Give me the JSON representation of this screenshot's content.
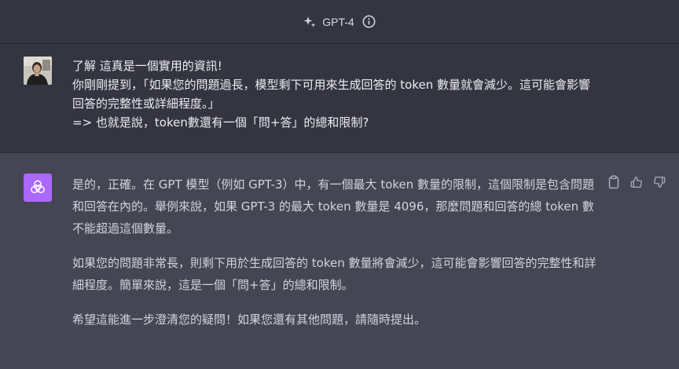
{
  "header": {
    "model_name": "GPT-4",
    "model_icon": "sparkle-icon",
    "info_icon": "info-icon"
  },
  "user_message": {
    "avatar": "user-avatar-photo",
    "text": "了解 這真是一個實用的資訊!\n你剛剛提到，「如果您的問題過長，模型剩下可用來生成回答的 token 數量就會減少。這可能會影響回答的完整性或詳細程度。」\n=> 也就是說，token數還有一個「問+答」的總和限制?"
  },
  "assistant_message": {
    "avatar": "openai-logo-icon",
    "paragraphs": [
      "是的，正確。在 GPT 模型（例如 GPT-3）中，有一個最大 token 數量的限制，這個限制是包含問題和回答在內的。舉例來說，如果 GPT-3 的最大 token 數量是 4096，那麼問題和回答的總 token 數不能超過這個數量。",
      "如果您的問題非常長，則剩下用於生成回答的 token 數量將會減少，這可能會影響回答的完整性和詳細程度。簡單來說，這是一個「問+答」的總和限制。",
      "希望這能進一步澄清您的疑問！如果您還有其他問題，請隨時提出。"
    ],
    "actions": [
      "copy-icon",
      "thumbs-up-icon",
      "thumbs-down-icon"
    ]
  },
  "colors": {
    "header_bg": "#343541",
    "user_bg": "#343541",
    "assistant_bg": "#444654",
    "gpt_avatar": "#ab68ff",
    "text": "#ececf1"
  }
}
